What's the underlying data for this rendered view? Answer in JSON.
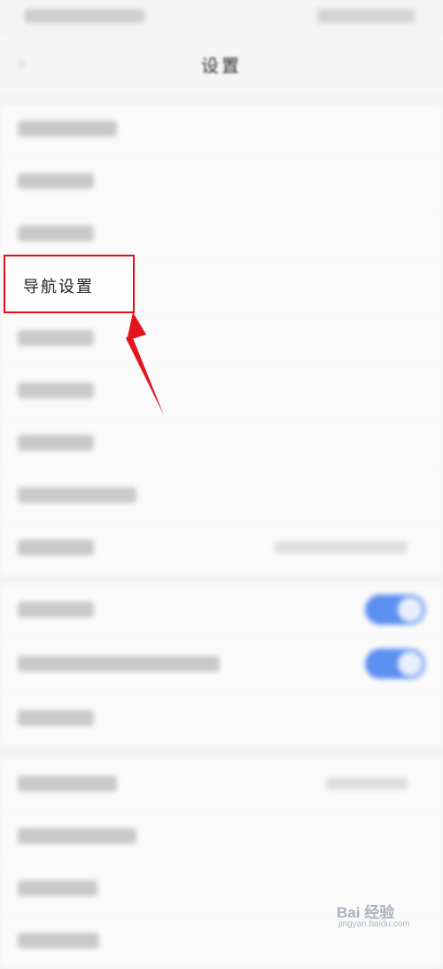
{
  "header": {
    "title": "设置",
    "back_icon": "chevron-left-icon"
  },
  "highlighted_item": {
    "label": "导航设置"
  },
  "watermark": {
    "main": "Bai 经验",
    "sub": "jingyan.baidu.com"
  },
  "colors": {
    "highlight_border": "#e0101a",
    "toggle_on": "#5b8ff0",
    "background": "#f3f3f3"
  }
}
